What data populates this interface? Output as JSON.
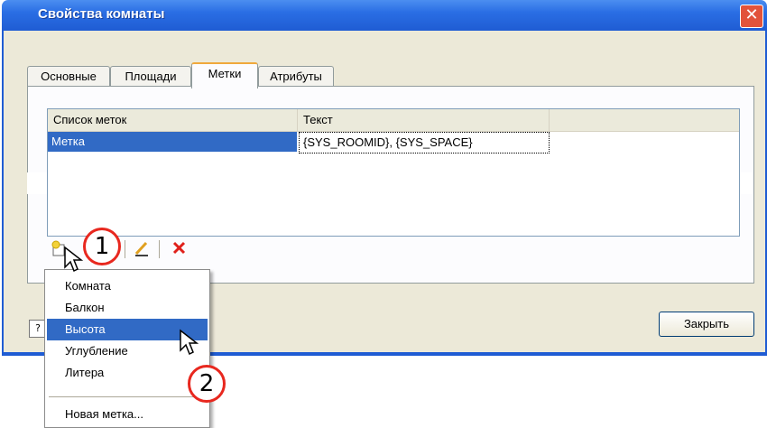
{
  "window": {
    "title": "Свойства комнаты",
    "close_symbol": "✕"
  },
  "tabs": [
    {
      "label": "Основные"
    },
    {
      "label": "Площади"
    },
    {
      "label": "Метки"
    },
    {
      "label": "Атрибуты"
    }
  ],
  "active_tab": "Метки",
  "list": {
    "columns": [
      "Список меток",
      "Текст"
    ],
    "rows": [
      {
        "name": "Метка",
        "text": "{SYS_ROOMID}, {SYS_SPACE}"
      }
    ]
  },
  "toolbar": {
    "add_icon": "new-label-icon",
    "edit_icon": "pencil-icon",
    "delete_icon": "delete-x-icon"
  },
  "menu": {
    "items": [
      "Комната",
      "Балкон",
      "Высота",
      "Углубление",
      "Литера"
    ],
    "highlighted": "Высота",
    "new_item": "Новая метка..."
  },
  "buttons": {
    "close": "Закрыть",
    "help": "?"
  },
  "callouts": [
    "1",
    "2"
  ],
  "colors": {
    "title_bar": "#2a6ee4",
    "selection": "#316ac5",
    "callout_ring": "#e8281f",
    "tab_accent": "#f0a93c"
  }
}
